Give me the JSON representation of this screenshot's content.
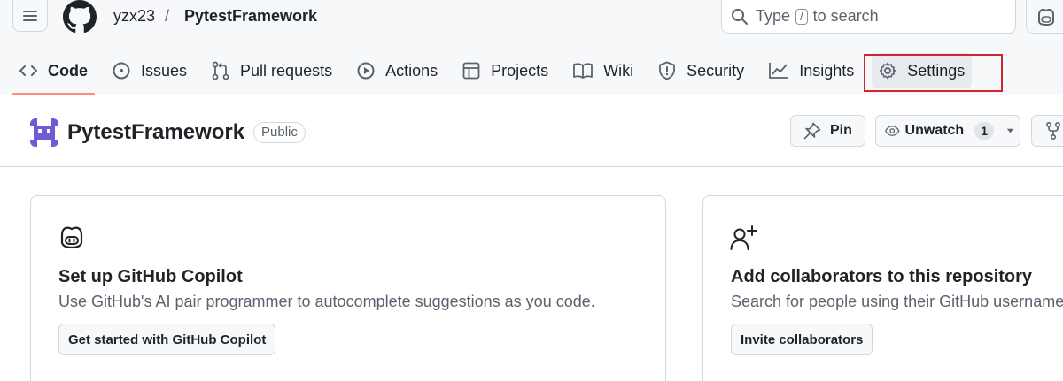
{
  "header": {
    "owner": "yzx23",
    "separator": "/",
    "repo": "PytestFramework",
    "search": {
      "prefix": "Type",
      "key": "/",
      "suffix": "to search"
    }
  },
  "tabs": [
    {
      "label": "Code",
      "icon": "code-icon",
      "selected": true
    },
    {
      "label": "Issues",
      "icon": "issue-opened-icon"
    },
    {
      "label": "Pull requests",
      "icon": "git-pull-request-icon"
    },
    {
      "label": "Actions",
      "icon": "play-icon"
    },
    {
      "label": "Projects",
      "icon": "table-icon"
    },
    {
      "label": "Wiki",
      "icon": "book-icon"
    },
    {
      "label": "Security",
      "icon": "shield-icon"
    },
    {
      "label": "Insights",
      "icon": "graph-icon"
    },
    {
      "label": "Settings",
      "icon": "gear-icon",
      "highlighted": true
    }
  ],
  "repo": {
    "name": "PytestFramework",
    "visibility": "Public",
    "pin_label": "Pin",
    "watch_label": "Unwatch",
    "watch_count": "1"
  },
  "cards": [
    {
      "icon": "copilot-icon",
      "title": "Set up GitHub Copilot",
      "description": "Use GitHub's AI pair programmer to autocomplete suggestions as you code.",
      "button": "Get started with GitHub Copilot"
    },
    {
      "icon": "person-add-icon",
      "title": "Add collaborators to this repository",
      "description": "Search for people using their GitHub username",
      "button": "Invite collaborators"
    }
  ],
  "colors": {
    "accent_underline": "#fd8c73",
    "highlight_border": "#d1242f",
    "text": "#1f2328",
    "muted": "#59636e"
  }
}
